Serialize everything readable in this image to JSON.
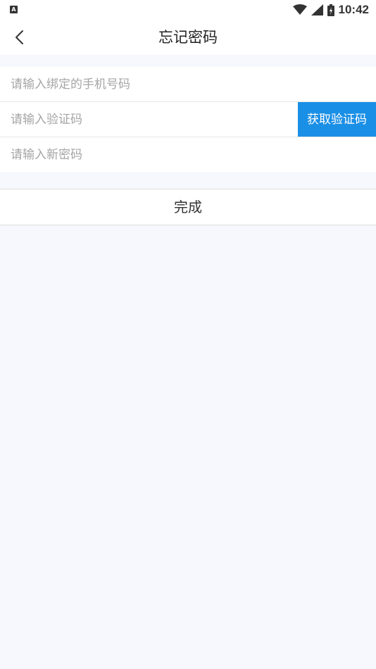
{
  "status_bar": {
    "app_icon": "A",
    "time": "10:42",
    "icons": [
      "wifi-icon",
      "signal-icon",
      "battery-icon"
    ]
  },
  "header": {
    "title": "忘记密码",
    "back_icon": "chevron-left-icon"
  },
  "form": {
    "phone_placeholder": "请输入绑定的手机号码",
    "phone_value": "",
    "code_placeholder": "请输入验证码",
    "code_value": "",
    "get_code_label": "获取验证码",
    "new_password_placeholder": "请输入新密码",
    "new_password_value": ""
  },
  "actions": {
    "done_label": "完成"
  },
  "colors": {
    "accent": "#1a8fe6",
    "background": "#f7f8fd",
    "placeholder": "#a5a5a5"
  }
}
